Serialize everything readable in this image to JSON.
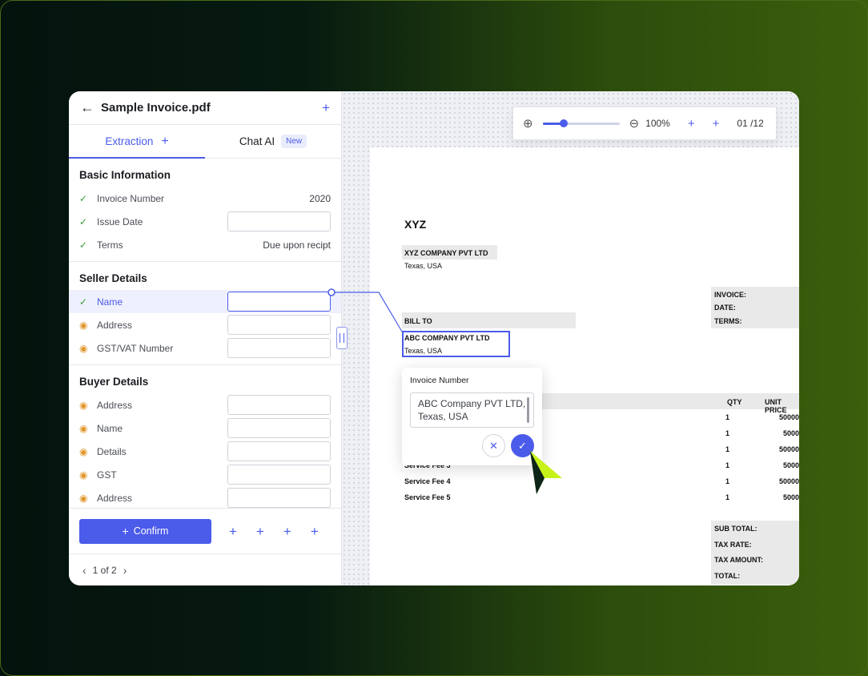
{
  "file": {
    "title": "Sample Invoice.pdf"
  },
  "tabs": {
    "extraction": "Extraction",
    "chat": "Chat AI",
    "chat_badge": "New"
  },
  "basic": {
    "title": "Basic Information",
    "rows": [
      {
        "label": "Invoice Number",
        "value": "2020"
      },
      {
        "label": "Issue Date",
        "value": ""
      },
      {
        "label": "Terms",
        "value": "Due upon recipt"
      }
    ]
  },
  "seller": {
    "title": "Seller Details",
    "rows": [
      {
        "label": "Name"
      },
      {
        "label": "Address"
      },
      {
        "label": "GST/VAT Number"
      }
    ]
  },
  "buyer": {
    "title": "Buyer Details",
    "rows": [
      {
        "label": "Address"
      },
      {
        "label": "Name"
      },
      {
        "label": "Details"
      },
      {
        "label": "GST"
      },
      {
        "label": "Address"
      }
    ]
  },
  "footer": {
    "confirm": "Confirm"
  },
  "pager": {
    "text": "1 of 2"
  },
  "toolbar": {
    "zoom": "100%",
    "page": "01 /12",
    "zoom_level": 0.28
  },
  "doc": {
    "heading": "XYZ",
    "seller_name": "XYZ COMPANY PVT LTD",
    "seller_loc": "Texas, USA",
    "invoice_label": "INVOICE:",
    "date_label": "DATE:",
    "terms_label": "TERMS:",
    "bill_to": "BILL TO",
    "buyer_name": "ABC COMPANY PVT LTD",
    "buyer_loc": "Texas, USA",
    "qty_header": "QTY",
    "price_header": "UNIT PRICE",
    "lines": [
      {
        "item": "",
        "qty": "1",
        "price": "50000"
      },
      {
        "item": "",
        "qty": "1",
        "price": "5000"
      },
      {
        "item": "",
        "qty": "1",
        "price": "50000"
      },
      {
        "item": "Service Fee 3",
        "qty": "1",
        "price": "5000"
      },
      {
        "item": "Service Fee 4",
        "qty": "1",
        "price": "50000"
      },
      {
        "item": "Service Fee 5",
        "qty": "1",
        "price": "5000"
      }
    ],
    "sub_total": "SUB TOTAL:",
    "tax_rate": "TAX RATE:",
    "tax_amount": "TAX AMOUNT:",
    "total": "TOTAL:"
  },
  "popup": {
    "title": "Invoice Number",
    "line1": "ABC Company PVT LTD,",
    "line2": "Texas, USA"
  },
  "colors": {
    "accent": "#4b5bea",
    "check": "#3b9a3b",
    "eye": "#e1962b",
    "cursor": "#c6f21a"
  }
}
